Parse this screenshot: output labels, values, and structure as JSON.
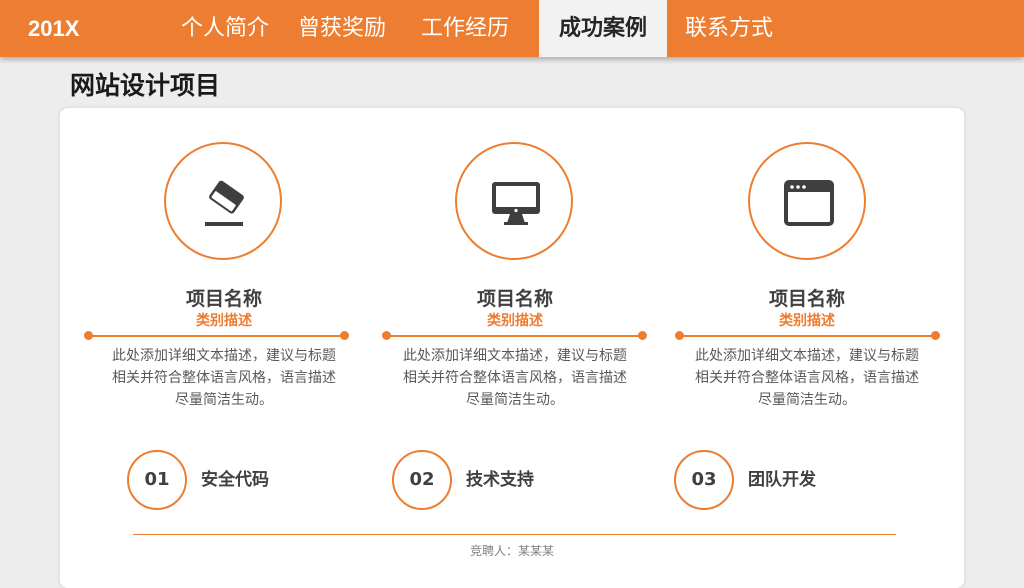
{
  "header": {
    "brand": "201X",
    "nav": [
      {
        "label": "个人简介",
        "active": false
      },
      {
        "label": "曾获奖励",
        "active": false
      },
      {
        "label": "工作经历",
        "active": false
      },
      {
        "label": "成功案例",
        "active": true
      },
      {
        "label": "联系方式",
        "active": false
      }
    ],
    "accent_color": "#ed7d31"
  },
  "section": {
    "title": "网站设计项目"
  },
  "cards": [
    {
      "icon": "eraser-icon",
      "title": "项目名称",
      "subtitle": "类别描述",
      "desc_lines": [
        "此处添加详细文本描述，建议与标题",
        "相关并符合整体语言风格，语言描述",
        "尽量简洁生动。"
      ]
    },
    {
      "icon": "monitor-icon",
      "title": "项目名称",
      "subtitle": "类别描述",
      "desc_lines": [
        "此处添加详细文本描述，建议与标题",
        "相关并符合整体语言风格，语言描述",
        "尽量简洁生动。"
      ]
    },
    {
      "icon": "browser-window-icon",
      "title": "项目名称",
      "subtitle": "类别描述",
      "desc_lines": [
        "此处添加详细文本描述，建议与标题",
        "相关并符合整体语言风格，语言描述",
        "尽量简洁生动。"
      ]
    }
  ],
  "features": [
    {
      "num": "01",
      "label": "安全代码"
    },
    {
      "num": "02",
      "label": "技术支持"
    },
    {
      "num": "03",
      "label": "团队开发"
    }
  ],
  "footer": {
    "text": "竞聘人：某某某"
  }
}
